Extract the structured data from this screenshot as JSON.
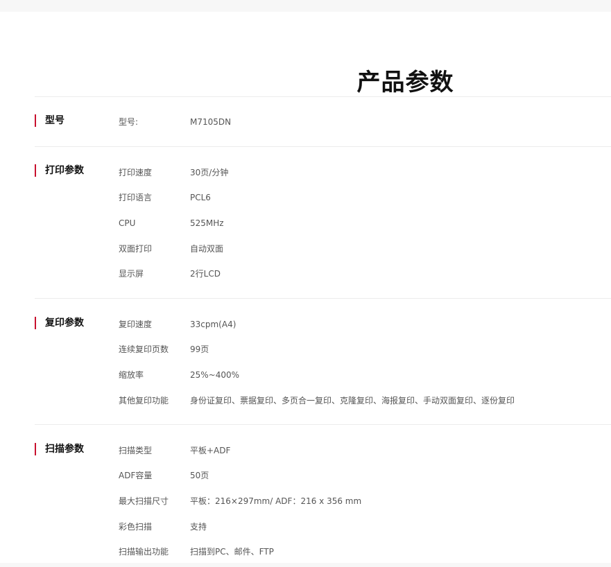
{
  "page": {
    "title": "产品参数"
  },
  "sections": [
    {
      "title": "型号",
      "rows": [
        {
          "label": "型号:",
          "value": "M7105DN"
        }
      ]
    },
    {
      "title": "打印参数",
      "rows": [
        {
          "label": "打印速度",
          "value": "30页/分钟"
        },
        {
          "label": "打印语言",
          "value": "PCL6"
        },
        {
          "label": "CPU",
          "value": "525MHz"
        },
        {
          "label": "双面打印",
          "value": "自动双面"
        },
        {
          "label": "显示屏",
          "value": "2行LCD"
        }
      ]
    },
    {
      "title": "复印参数",
      "rows": [
        {
          "label": "复印速度",
          "value": "33cpm(A4)"
        },
        {
          "label": "连续复印页数",
          "value": "99页"
        },
        {
          "label": "缩放率",
          "value": "25%~400%"
        },
        {
          "label": "其他复印功能",
          "value": "身份证复印、票据复印、多页合一复印、克隆复印、海报复印、手动双面复印、逐份复印"
        }
      ]
    },
    {
      "title": "扫描参数",
      "rows": [
        {
          "label": "扫描类型",
          "value": "平板+ADF"
        },
        {
          "label": "ADF容量",
          "value": "50页"
        },
        {
          "label": "最大扫描尺寸",
          "value": "平板：216×297mm/ ADF：216 x 356 mm"
        },
        {
          "label": "彩色扫描",
          "value": "支持"
        },
        {
          "label": "扫描输出功能",
          "value": "扫描到PC、邮件、FTP"
        }
      ]
    }
  ]
}
